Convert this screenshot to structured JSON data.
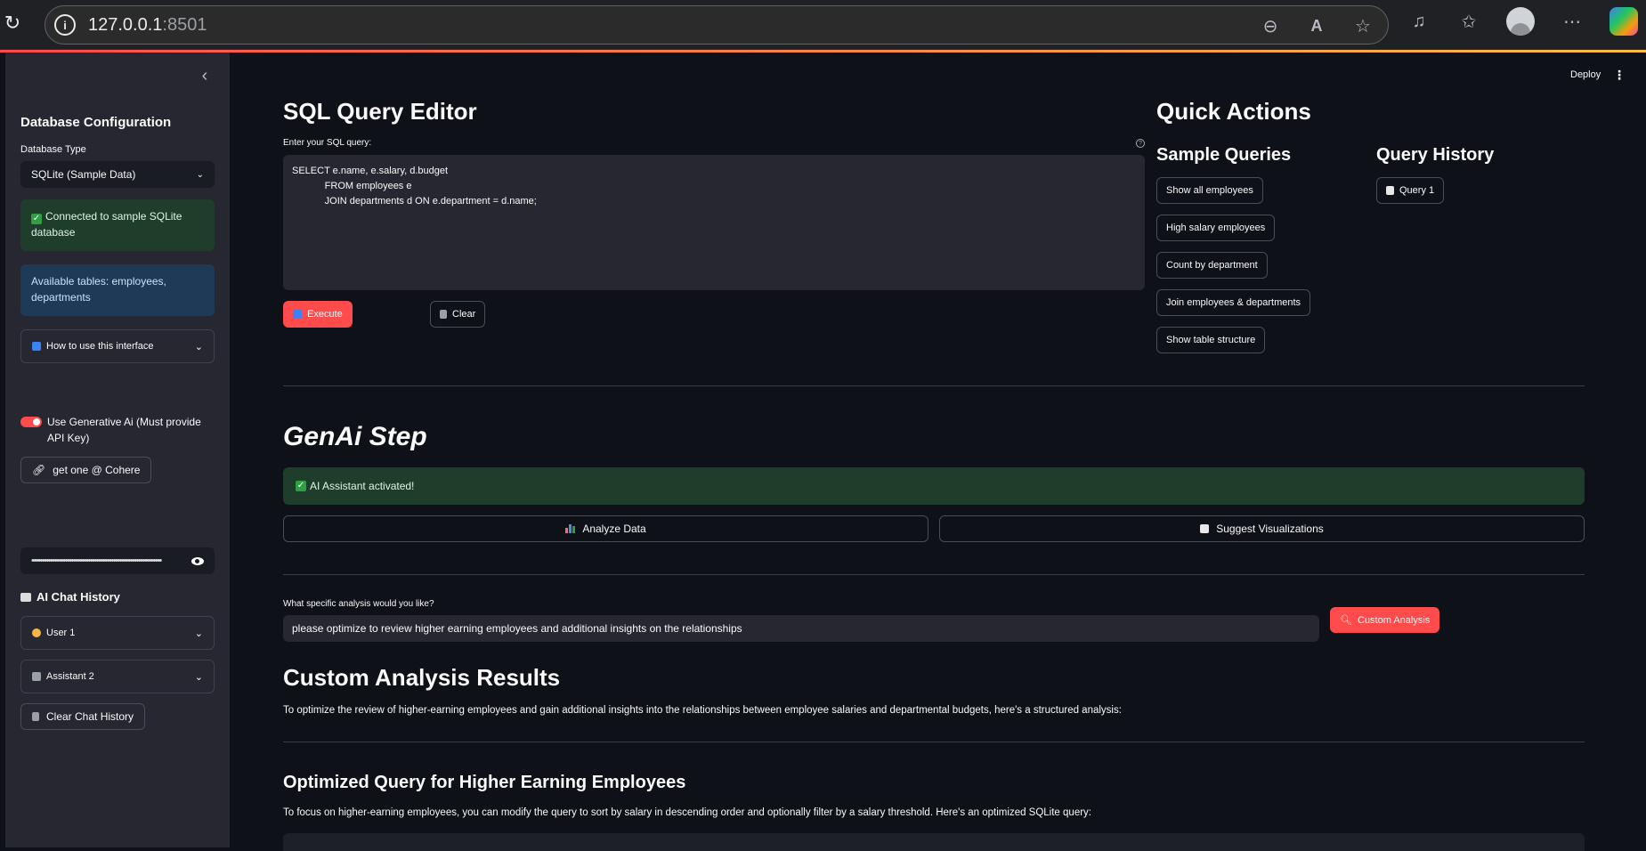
{
  "browser": {
    "url_host": "127.0.0.1",
    "url_port": ":8501"
  },
  "sidebar": {
    "db_config_title": "Database Configuration",
    "db_type_label": "Database Type",
    "db_type_value": "SQLite (Sample Data)",
    "connected_msg": "Connected to sample SQLite database",
    "tables_msg": "Available tables: employees, departments",
    "howto_label": "How to use this interface",
    "genai_toggle_label": "Use Generative Ai (Must provide API Key)",
    "cohere_link": "get one @ Cohere",
    "api_key_masked": "••••••••••••••••••••••••••••••••••••••••••••••••••••••••••••••",
    "chat_history_title": "AI Chat History",
    "chat_items": [
      "User 1",
      "Assistant 2"
    ],
    "clear_chat_label": "Clear Chat History"
  },
  "header": {
    "deploy_label": "Deploy",
    "menu_glyph": "⋮"
  },
  "editor": {
    "title": "SQL Query Editor",
    "query_label": "Enter your SQL query:",
    "query_text": "SELECT e.name, e.salary, d.budget\n            FROM employees e\n            JOIN departments d ON e.department = d.name;",
    "execute_label": "Execute",
    "clear_label": "Clear"
  },
  "quick_actions": {
    "title": "Quick Actions",
    "samples_title": "Sample Queries",
    "samples": [
      "Show all employees",
      "High salary employees",
      "Count by department",
      "Join employees & departments",
      "Show table structure"
    ],
    "history_title": "Query History",
    "history": [
      "Query 1"
    ]
  },
  "genai": {
    "title": "GenAi Step",
    "activated_msg": "AI Assistant activated!",
    "analyze_label": "Analyze Data",
    "suggest_label": "Suggest Visualizations",
    "specific_label": "What specific analysis would you like?",
    "specific_value": "please optimize to review higher earning employees and additional insights on the relationships",
    "custom_btn": "Custom Analysis"
  },
  "results": {
    "title": "Custom Analysis Results",
    "intro": "To optimize the review of higher-earning employees and gain additional insights into the relationships between employee salaries and departmental budgets, here's a structured analysis:",
    "section_title": "Optimized Query for Higher Earning Employees",
    "section_text": "To focus on higher-earning employees, you can modify the query to sort by salary in descending order and optionally filter by a salary threshold. Here's an optimized SQLite query:"
  },
  "colors": {
    "accent": "#ff4b4b",
    "success_bg": "#1f3d2b",
    "info_bg": "#1f3a57",
    "sidebar_bg": "#262730",
    "main_bg": "#0e1117"
  }
}
